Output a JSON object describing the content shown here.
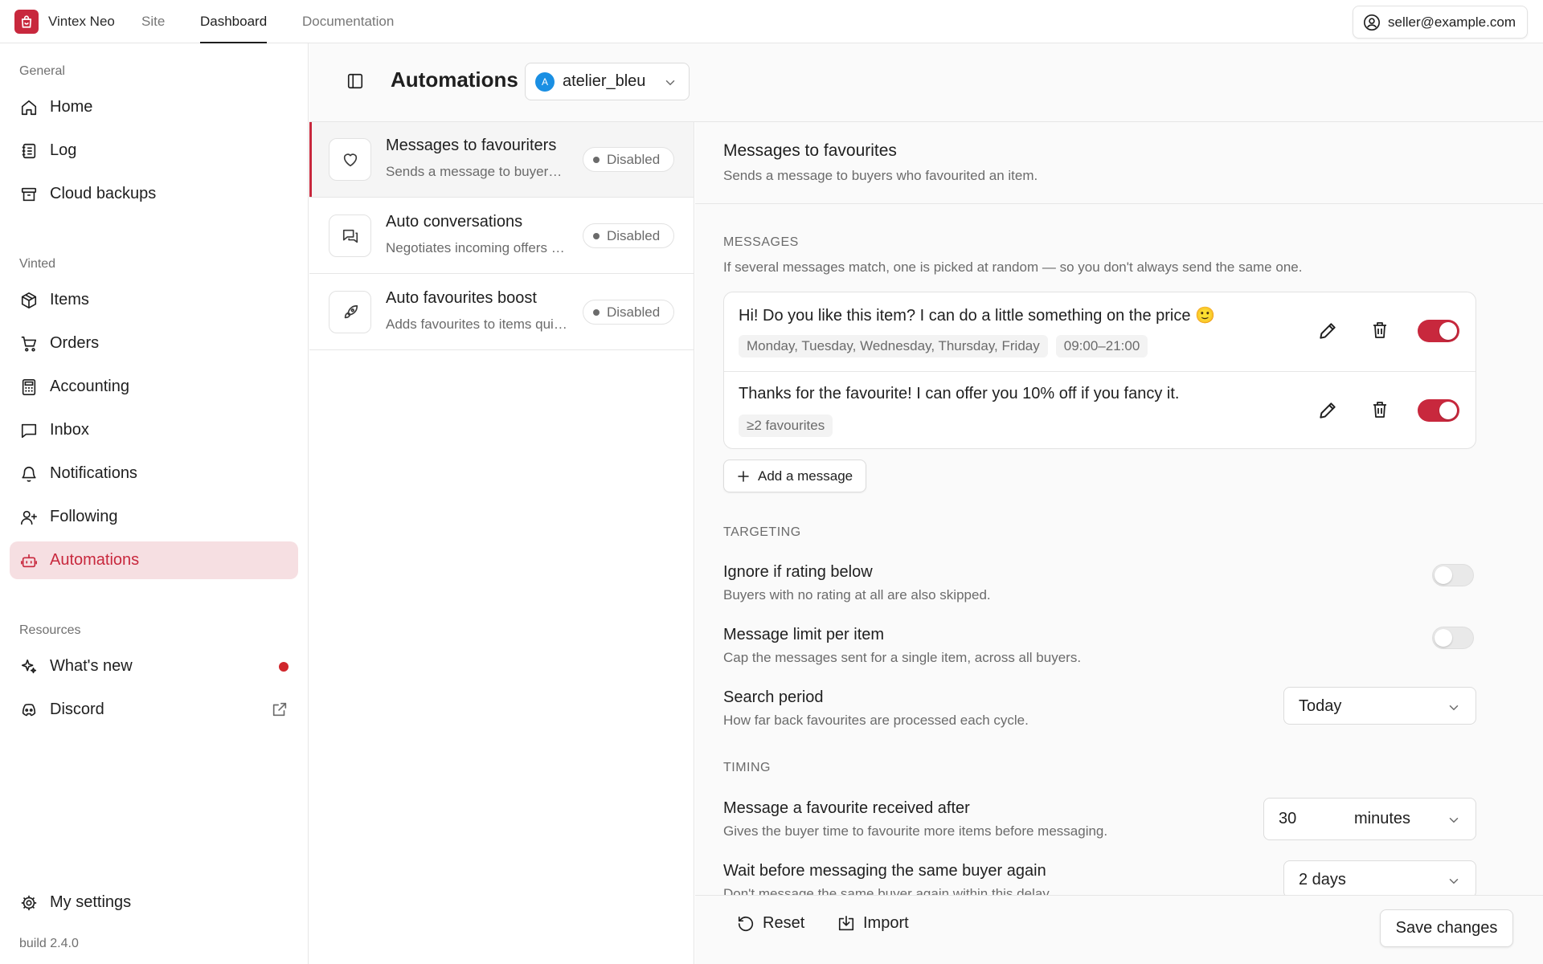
{
  "topbar": {
    "brand": "Vintex Neo",
    "nav": [
      "Site",
      "Dashboard",
      "Documentation"
    ],
    "active_nav": "Dashboard",
    "account_email": "seller@example.com"
  },
  "sidebar": {
    "groups": [
      {
        "label": "General",
        "items": [
          {
            "label": "Home",
            "icon": "home-icon"
          },
          {
            "label": "Log",
            "icon": "log-icon"
          },
          {
            "label": "Cloud backups",
            "icon": "archive-icon"
          }
        ]
      },
      {
        "label": "Vinted",
        "items": [
          {
            "label": "Items",
            "icon": "package-icon"
          },
          {
            "label": "Orders",
            "icon": "cart-icon"
          },
          {
            "label": "Accounting",
            "icon": "calculator-icon"
          },
          {
            "label": "Inbox",
            "icon": "message-icon"
          },
          {
            "label": "Notifications",
            "icon": "bell-icon"
          },
          {
            "label": "Following",
            "icon": "user-plus-icon"
          },
          {
            "label": "Automations",
            "icon": "bot-icon",
            "active": true
          }
        ]
      },
      {
        "label": "Resources",
        "items": [
          {
            "label": "What's new",
            "icon": "sparkles-icon",
            "has_new_dot": true
          },
          {
            "label": "Discord",
            "icon": "discord-icon",
            "external": true
          }
        ]
      }
    ],
    "settings_label": "My settings",
    "build": "build 2.4.0"
  },
  "main": {
    "title": "Automations",
    "account": {
      "avatar_letter": "A",
      "name": "atelier_bleu"
    }
  },
  "automations": [
    {
      "title": "Messages to favouriters",
      "desc": "Sends a message to buyers who favourited an item.",
      "status": "Disabled",
      "icon": "heart-icon",
      "active": true
    },
    {
      "title": "Auto conversations",
      "desc": "Negotiates incoming offers automatically.",
      "status": "Disabled",
      "icon": "chat-icon"
    },
    {
      "title": "Auto favourites boost",
      "desc": "Adds favourites to items quickly.",
      "status": "Disabled",
      "icon": "rocket-icon"
    }
  ],
  "detail": {
    "title": "Messages to favourites",
    "subtitle": "Sends a message to buyers who favourited an item.",
    "messages_section": {
      "label": "MESSAGES",
      "help": "If several messages match, one is picked at random — so you don't always send the same one.",
      "items": [
        {
          "text": "Hi! Do you like this item? I can do a little something on the price 🙂",
          "chips": [
            "Monday, Tuesday, Wednesday, Thursday, Friday",
            "09:00–21:00"
          ],
          "enabled": true
        },
        {
          "text": "Thanks for the favourite! I can offer you 10% off if you fancy it.",
          "chips": [
            "≥2 favourites"
          ],
          "enabled": true
        }
      ],
      "add_label": "Add a message"
    },
    "targeting": {
      "label": "TARGETING",
      "ignore_rating": {
        "title": "Ignore if rating below",
        "help": "Buyers with no rating at all are also skipped.",
        "enabled": false
      },
      "message_limit": {
        "title": "Message limit per item",
        "help": "Cap the messages sent for a single item, across all buyers.",
        "enabled": false
      },
      "search_period": {
        "title": "Search period",
        "help": "How far back favourites are processed each cycle.",
        "value": "Today"
      }
    },
    "timing": {
      "label": "TIMING",
      "after": {
        "title": "Message a favourite received after",
        "help": "Gives the buyer time to favourite more items before messaging.",
        "value": "30",
        "unit": "minutes"
      },
      "wait": {
        "title": "Wait before messaging the same buyer again",
        "help": "Don't message the same buyer again within this delay.",
        "value": "2 days"
      }
    },
    "footer": {
      "reset": "Reset",
      "import": "Import",
      "save": "Save changes"
    }
  },
  "colors": {
    "accent": "#c8283d",
    "accent_soft": "#f6dfe2",
    "avatar": "#1a8fe3"
  }
}
